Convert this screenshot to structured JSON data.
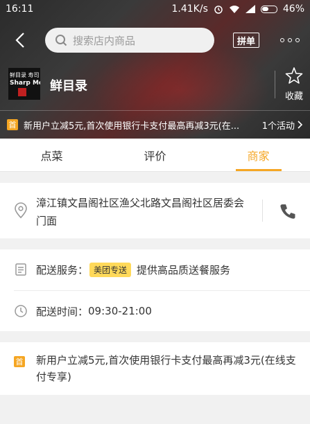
{
  "status_bar": {
    "time": "16:11",
    "network_speed": "1.41K/s",
    "battery": "46%"
  },
  "nav": {
    "search_placeholder": "搜索店内商品",
    "pindan_label": "拼单"
  },
  "store": {
    "logo_line1": "鲜目录 寿司",
    "logo_line2": "Sharp Menu",
    "name": "鲜目录",
    "favorite_label": "收藏"
  },
  "promo_bar": {
    "badge": "首",
    "text": "新用户立减5元,首次使用银行卡支付最高再减3元(在...",
    "count_label": "1个活动"
  },
  "tabs": [
    {
      "label": "点菜",
      "active": false
    },
    {
      "label": "评价",
      "active": false
    },
    {
      "label": "商家",
      "active": true
    }
  ],
  "merchant": {
    "address": "漳江镇文昌阁社区渔父北路文昌阁社区居委会门面",
    "delivery_service_label": "配送服务：",
    "delivery_badge": "美团专送",
    "delivery_service_desc": "提供高品质送餐服务",
    "delivery_time_label": "配送时间：",
    "delivery_time": "09:30-21:00"
  },
  "promotion": {
    "badge": "首",
    "text": "新用户立减5元,首次使用银行卡支付最高再减3元(在线支付专享)"
  },
  "colors": {
    "accent": "#f5a623",
    "badge_yellow": "#ffd95a",
    "text": "#333333"
  }
}
